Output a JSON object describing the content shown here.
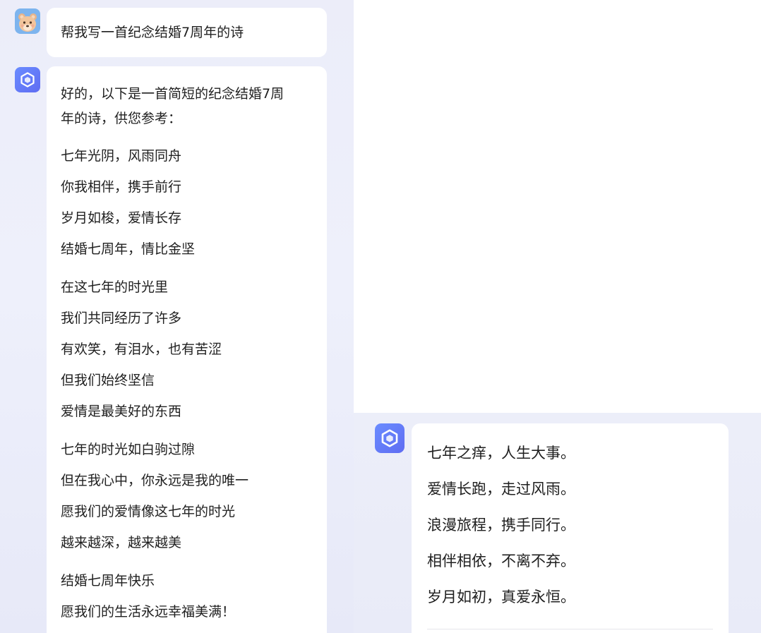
{
  "left_chat": {
    "user_message": "帮我写一首纪念结婚7周年的诗",
    "bot_intro_line1": "好的，以下是一首简短的纪念结婚7周",
    "bot_intro_line2": "年的诗，供您参考：",
    "poem_lines": [
      "七年光阴，风雨同舟",
      "你我相伴，携手前行",
      "岁月如梭，爱情长存",
      "结婚七周年，情比金坚",
      "在这七年的时光里",
      "我们共同经历了许多",
      "有欢笑，有泪水，也有苦涩",
      "但我们始终坚信",
      "爱情是最美好的东西",
      "七年的时光如白驹过隙",
      "但在我心中，你永远是我的唯一",
      "愿我们的爱情像这七年的时光",
      "越来越深，越来越美",
      "结婚七周年快乐",
      "愿我们的生活永远幸福美满！"
    ]
  },
  "right_chat": {
    "poem_lines": [
      "七年之痒，人生大事。",
      "爱情长跑，走过风雨。",
      "浪漫旅程，携手同行。",
      "相伴相依，不离不弃。",
      "岁月如初，真爱永恒。"
    ]
  },
  "icons": {
    "user_avatar": "bear-avatar-icon",
    "bot_avatar": "cube-logo-icon"
  },
  "colors": {
    "chat_background": "#eceef9",
    "bubble": "#ffffff",
    "bot_avatar": "#6a7df5",
    "user_avatar": "#7db4ee"
  }
}
